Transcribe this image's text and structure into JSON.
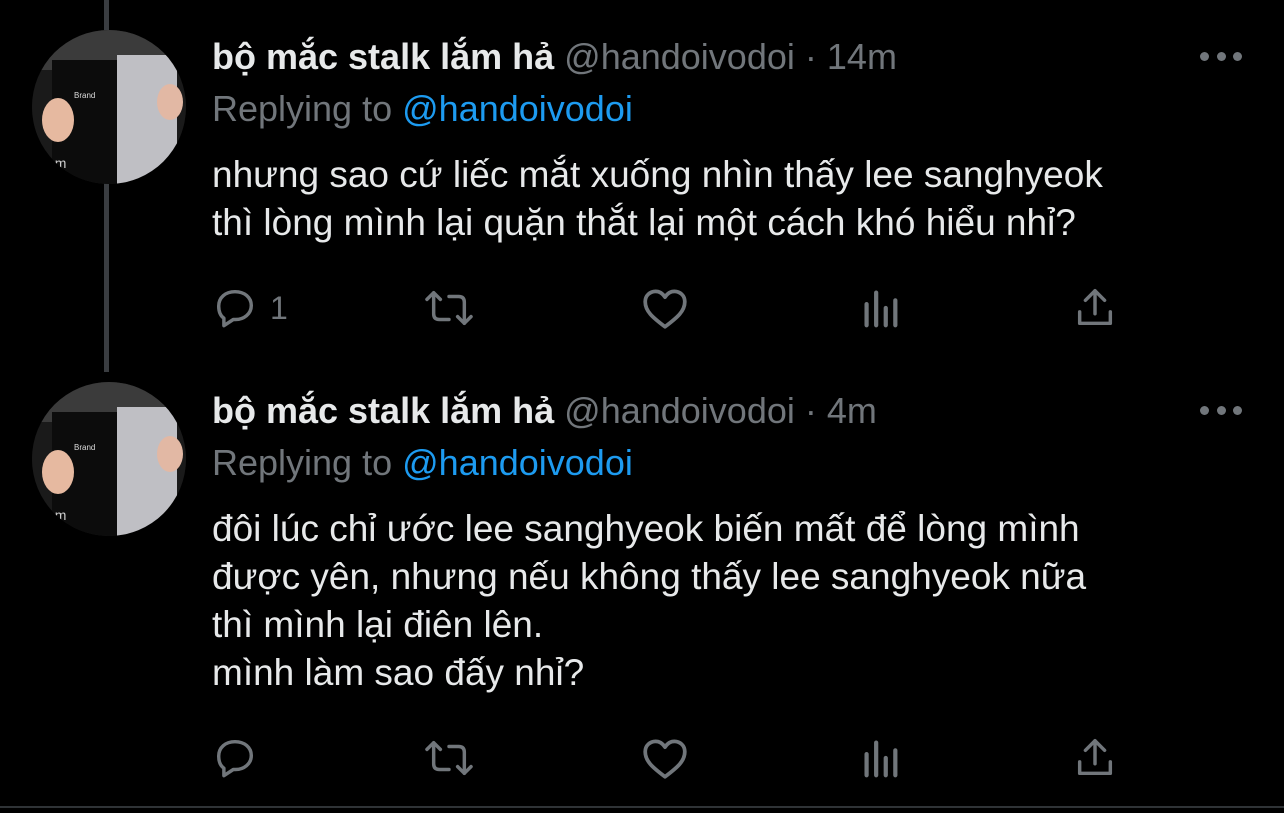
{
  "theme": {
    "background": "#000000",
    "text_primary": "#e7e9ea",
    "text_secondary": "#71767b",
    "accent": "#1d9bf0"
  },
  "tweets": [
    {
      "author_name": "bộ mắc stalk lắm hả",
      "handle": "@handoivodoi",
      "separator": "·",
      "time": "14m",
      "replying_label": "Replying to",
      "replying_to": "@handoivodoi",
      "text": "nhưng sao cứ liếc mắt xuống nhìn thấy lee sanghyeok\nthì lòng mình lại quặn thắt lại một cách khó hiểu nhỉ?",
      "reply_count": "1",
      "icons": [
        "reply-icon",
        "retweet-icon",
        "like-icon",
        "stats-icon",
        "share-icon",
        "more-icon"
      ]
    },
    {
      "author_name": "bộ mắc stalk lắm hả",
      "handle": "@handoivodoi",
      "separator": "·",
      "time": "4m",
      "replying_label": "Replying to",
      "replying_to": "@handoivodoi",
      "text": "đôi lúc chỉ ước lee sanghyeok biến mất để lòng mình\nđược yên, nhưng nếu không thấy lee sanghyeok nữa\nthì mình lại điên lên.\nmình làm sao đấy nhỉ?",
      "reply_count": "",
      "icons": [
        "reply-icon",
        "retweet-icon",
        "like-icon",
        "stats-icon",
        "share-icon",
        "more-icon"
      ]
    }
  ]
}
